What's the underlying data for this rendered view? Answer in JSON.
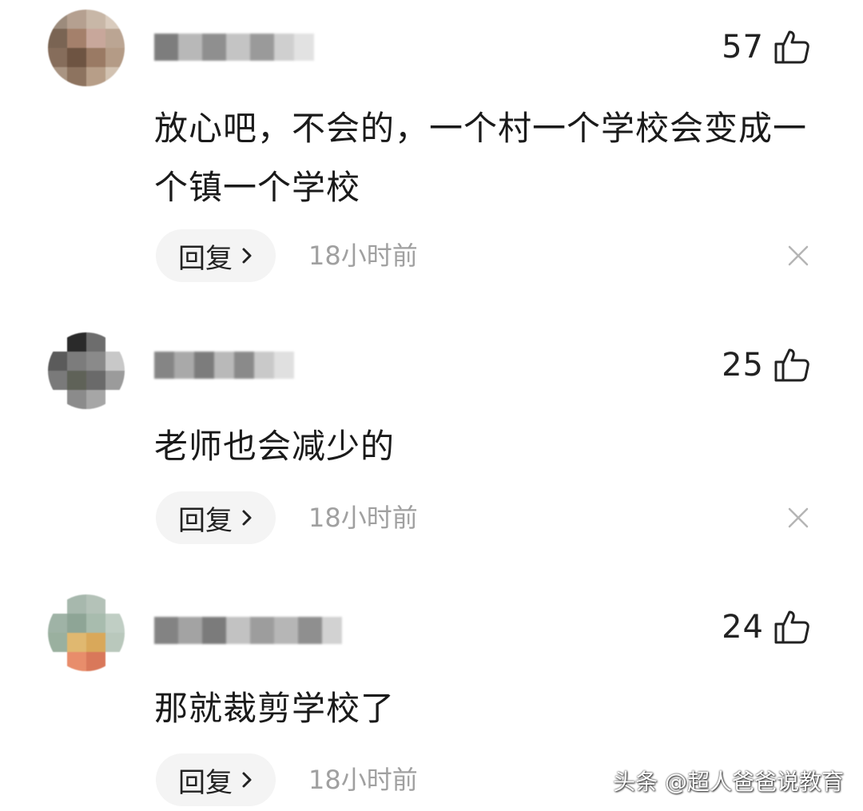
{
  "colors": {
    "text": "#222222",
    "muted": "#a0a0a0",
    "reply_bg": "#f4f4f4",
    "icon": "#222222"
  },
  "comments": [
    {
      "username": "",
      "likes": "57",
      "text": "放心吧，不会的，一个村一个学校会变成一个镇一个学校",
      "reply_label": "回复",
      "time": "18小时前"
    },
    {
      "username": "",
      "likes": "25",
      "text": "老师也会减少的",
      "reply_label": "回复",
      "time": "18小时前"
    },
    {
      "username": "",
      "likes": "24",
      "text": "那就裁剪学校了",
      "reply_label": "回复",
      "time": "18小时前"
    }
  ],
  "watermark": "头条 @超人爸爸说教育",
  "icons": {
    "like": "thumbs-up-icon",
    "close": "close-icon",
    "chevron": "chevron-right-icon"
  }
}
